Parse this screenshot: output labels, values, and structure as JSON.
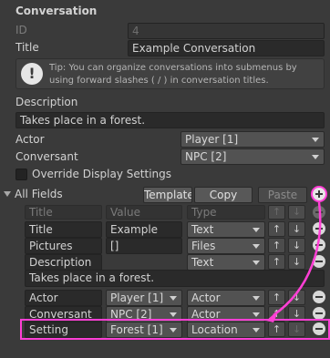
{
  "title": "Conversation",
  "id": {
    "label": "ID",
    "value": "4"
  },
  "title_field": {
    "label": "Title",
    "value": "Example Conversation"
  },
  "tip": "Tip: You can organize conversations into submenus by using forward slashes ( / ) in conversation titles.",
  "description": {
    "label": "Description",
    "value": "Takes place in a forest."
  },
  "actor": {
    "label": "Actor",
    "value": "Player [1]"
  },
  "conversant": {
    "label": "Conversant",
    "value": "NPC [2]"
  },
  "override": {
    "label": "Override Display Settings"
  },
  "all_fields": {
    "label": "All Fields",
    "buttons": {
      "template": "Template",
      "copy": "Copy",
      "paste": "Paste"
    },
    "headers": {
      "title": "Title",
      "value": "Value",
      "type": "Type"
    },
    "rows": [
      {
        "title": "Title",
        "value": "Example",
        "type": "Text"
      },
      {
        "title": "Pictures",
        "value": "[]",
        "type": "Files"
      },
      {
        "title": "Description",
        "value": "",
        "type": "Text"
      }
    ],
    "description_value": "Takes place in a forest.",
    "rows2": [
      {
        "title": "Actor",
        "value": "Player [1]",
        "type": "Actor"
      },
      {
        "title": "Conversant",
        "value": "NPC [2]",
        "type": "Actor"
      },
      {
        "title": "Setting",
        "value": "Forest [1]",
        "type": "Location"
      }
    ]
  },
  "colors": {
    "highlight": "#ff3fd5",
    "background": "#3a3a3a"
  },
  "icons": {
    "up": "↑",
    "down": "↓"
  }
}
